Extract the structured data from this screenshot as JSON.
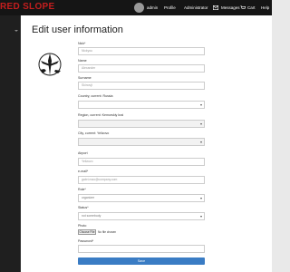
{
  "header": {
    "brand": "RED SLOPE",
    "user": "admin",
    "menu": [
      "Profile",
      "Administrator"
    ],
    "messages": "Messages",
    "cart": "Cart",
    "help": "Help"
  },
  "page": {
    "title": "Edit user information"
  },
  "form": {
    "nick": {
      "label": "Nick*",
      "value": "Nickyou"
    },
    "name": {
      "label": "Name",
      "value": "Alexander"
    },
    "surname": {
      "label": "Surname",
      "value": "Skinovjt"
    },
    "country": {
      "label": "Country, current: Russia",
      "value": ""
    },
    "region": {
      "label": "Region, current: Kemorskiy krai",
      "value": ""
    },
    "city": {
      "label": "City, current: Yelizovo",
      "value": ""
    },
    "airport": {
      "label": "Airport",
      "value": "Yelizovo"
    },
    "email": {
      "label": "e-mail*",
      "value": "gabri.mao@company.com"
    },
    "role": {
      "label": "Role*",
      "value": "organizer"
    },
    "status": {
      "label": "Status*",
      "value": "not somebody"
    },
    "photo": {
      "label": "Photo",
      "button": "Choose File",
      "file_text": "No file chosen"
    },
    "password": {
      "label": "Password*",
      "value": ""
    },
    "save": "Save"
  }
}
